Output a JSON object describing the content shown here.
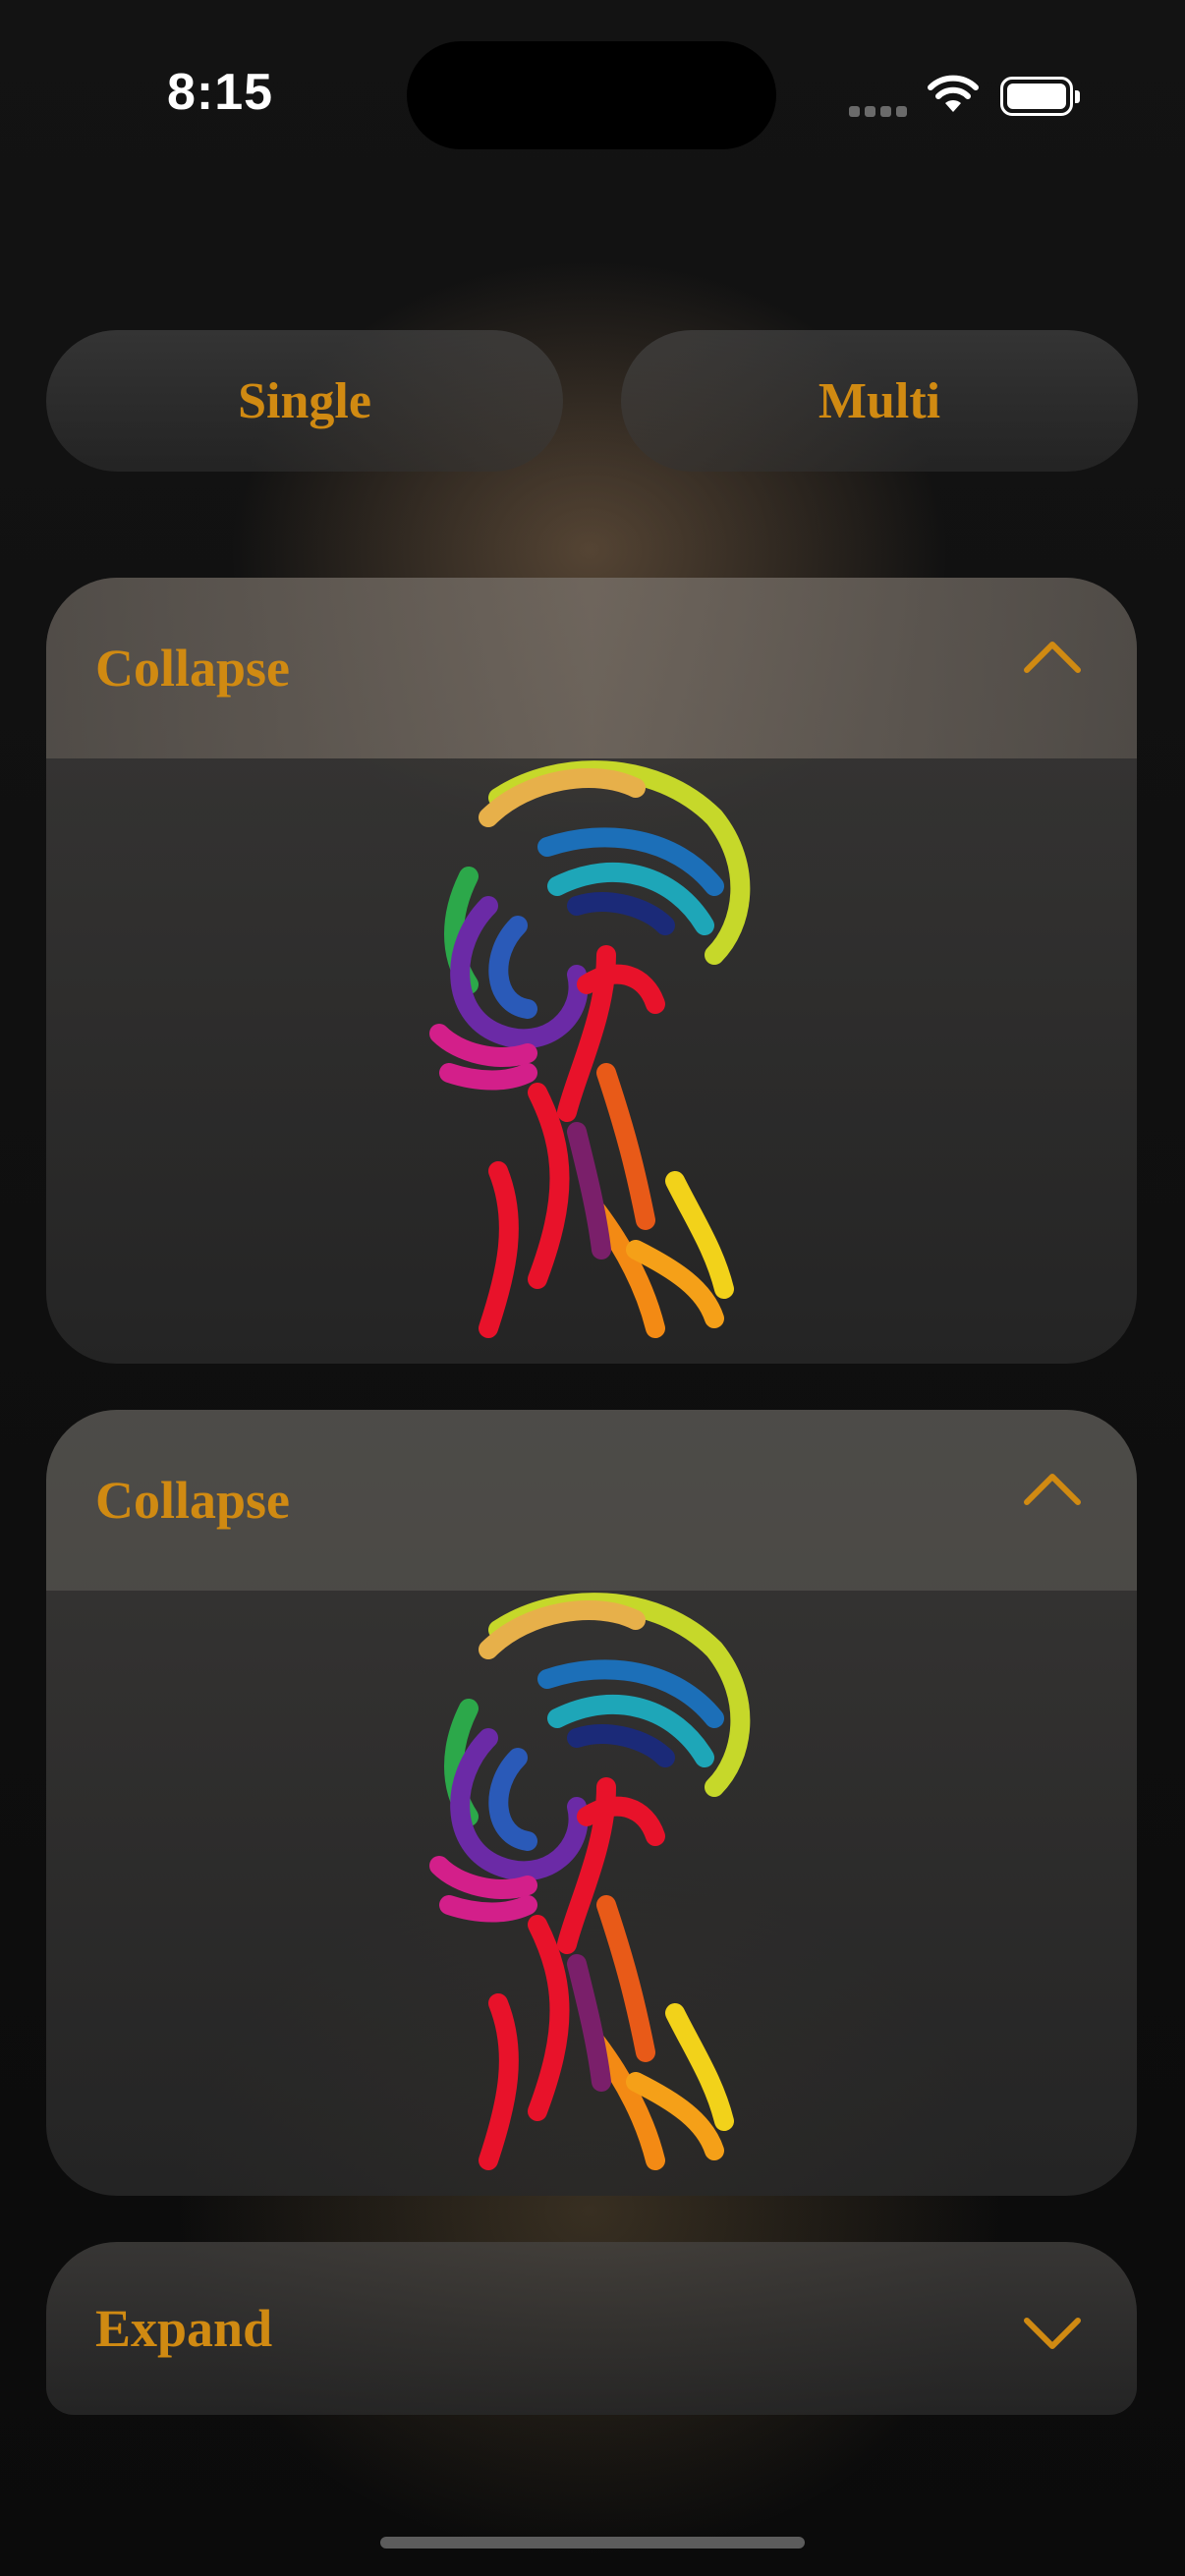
{
  "status_bar": {
    "time": "8:15",
    "icons": [
      "cellular-signal-icon",
      "wifi-icon",
      "battery-icon"
    ]
  },
  "mode_toggle": {
    "single_label": "Single",
    "multi_label": "Multi"
  },
  "accordion": {
    "items": [
      {
        "title": "Collapse",
        "state": "expanded",
        "chevron": "chevron-up-icon",
        "image": "colorful-head-illustration"
      },
      {
        "title": "Collapse",
        "state": "expanded",
        "chevron": "chevron-up-icon",
        "image": "colorful-head-illustration"
      },
      {
        "title": "Expand",
        "state": "collapsed",
        "chevron": "chevron-down-icon"
      }
    ]
  },
  "colors": {
    "accent": "#d08a12",
    "background": "#111111"
  }
}
